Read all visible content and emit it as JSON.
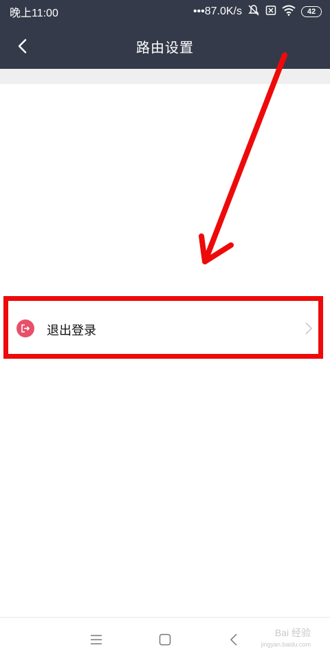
{
  "status_bar": {
    "time": "晚上11:00",
    "network_speed": "•••87.0K/s",
    "battery_level": "42",
    "icons": [
      "mute-icon",
      "sim-icon",
      "wifi-icon",
      "battery-icon"
    ]
  },
  "header": {
    "title": "路由设置",
    "back_icon": "chevron-left-icon"
  },
  "list": {
    "items": [
      {
        "label": "退出登录",
        "icon": "logout-icon",
        "icon_color": "#e8506a",
        "trailing_icon": "chevron-right-icon"
      }
    ]
  },
  "annotation": {
    "highlight_color": "#ee0a0a"
  },
  "nav_bar": {
    "buttons": [
      "menu-icon",
      "home-icon",
      "back-icon"
    ]
  },
  "watermark": {
    "text": "Bai 经验",
    "sub_text": "jingyan.baidu.com"
  },
  "colors": {
    "header_bg": "#353a4a",
    "page_bg": "#ffffff",
    "separator_bg": "#efefef"
  }
}
